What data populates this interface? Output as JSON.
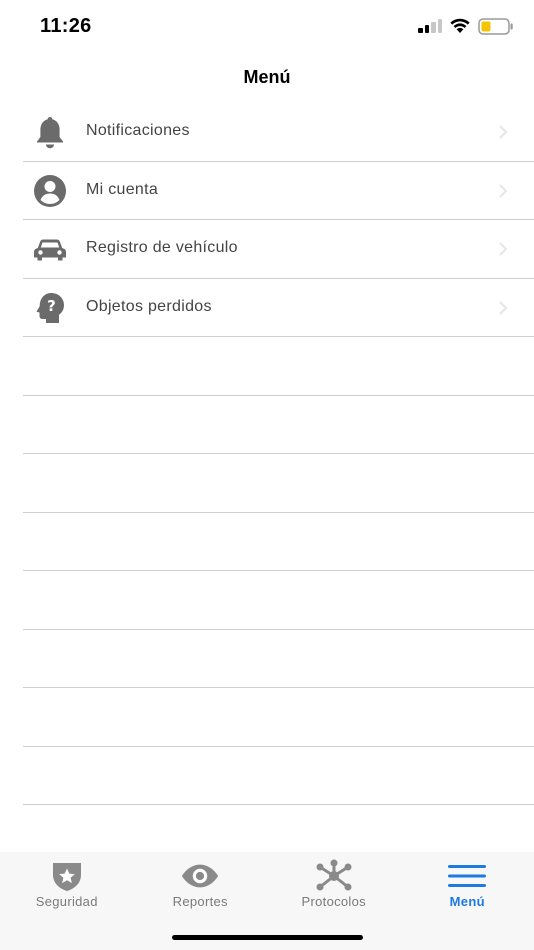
{
  "status_bar": {
    "time": "11:26",
    "battery_color": "#f5c400"
  },
  "header": {
    "title": "Menú"
  },
  "menu": {
    "items": [
      {
        "label": "Notificaciones",
        "icon": "bell-icon"
      },
      {
        "label": "Mi cuenta",
        "icon": "user-circle-icon"
      },
      {
        "label": "Registro de vehículo",
        "icon": "car-icon"
      },
      {
        "label": "Objetos perdidos",
        "icon": "head-question-icon"
      }
    ]
  },
  "tab_bar": {
    "tabs": [
      {
        "label": "Seguridad",
        "icon": "shield-star-icon",
        "active": false
      },
      {
        "label": "Reportes",
        "icon": "eye-icon",
        "active": false
      },
      {
        "label": "Protocolos",
        "icon": "network-icon",
        "active": false
      },
      {
        "label": "Menú",
        "icon": "hamburger-menu-icon",
        "active": true
      }
    ],
    "active_color": "#1f7ae0",
    "inactive_color": "#7a7a7a"
  }
}
